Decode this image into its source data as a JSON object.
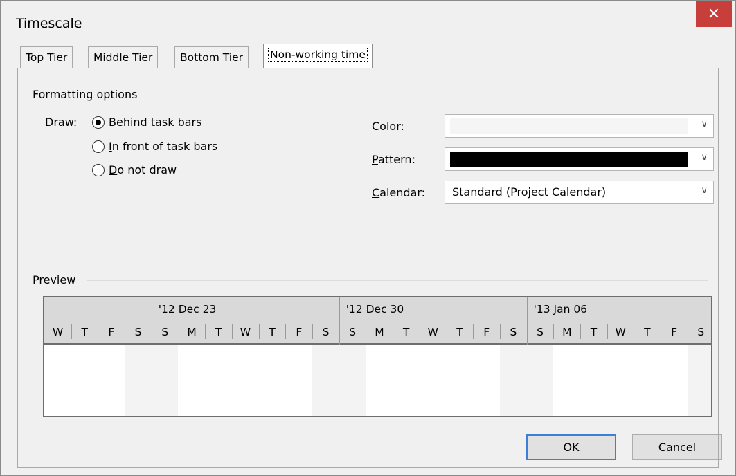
{
  "window": {
    "title": "Timescale",
    "close_glyph": "✕"
  },
  "tabs": [
    {
      "label": "Top Tier"
    },
    {
      "label": "Middle Tier"
    },
    {
      "label": "Bottom Tier"
    },
    {
      "label": "Non-working time",
      "active": true
    }
  ],
  "formatting": {
    "group_label": "Formatting options",
    "draw_label": "Draw:",
    "options": [
      {
        "prefix": "",
        "ul": "B",
        "rest": "ehind task bars",
        "selected": true
      },
      {
        "prefix": "",
        "ul": "I",
        "rest": "n front of task bars",
        "selected": false
      },
      {
        "prefix": "",
        "ul": "D",
        "rest": "o not draw",
        "selected": false
      }
    ],
    "color": {
      "pre": "Co",
      "ul": "l",
      "post": "or:",
      "swatch": "#f5f5f5"
    },
    "pattern": {
      "pre": "",
      "ul": "P",
      "post": "attern:",
      "swatch": "#000000"
    },
    "calendar": {
      "pre": "",
      "ul": "C",
      "post": "alendar:",
      "value": "Standard (Project Calendar)"
    }
  },
  "preview": {
    "label": "Preview",
    "weeks": [
      "'12 Dec 23",
      "'12 Dec 30",
      "'13 Jan 06"
    ],
    "days": [
      "W",
      "T",
      "F",
      "S",
      "S",
      "M",
      "T",
      "W",
      "T",
      "F",
      "S",
      "S",
      "M",
      "T",
      "W",
      "T",
      "F",
      "S",
      "S",
      "M",
      "T",
      "W",
      "T",
      "F",
      "S"
    ]
  },
  "buttons": {
    "ok": "OK",
    "cancel": "Cancel"
  }
}
